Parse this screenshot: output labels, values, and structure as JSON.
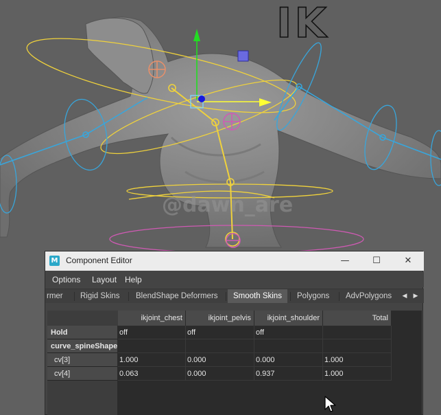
{
  "overlay": {
    "ik_label": "IK",
    "watermark": "@dawn_are"
  },
  "window": {
    "title": "Component Editor",
    "app_icon_letter": "M",
    "minimize_glyph": "—",
    "maximize_glyph": "☐",
    "close_glyph": "✕"
  },
  "menu": {
    "items": [
      "Options",
      "Layout",
      "Help"
    ]
  },
  "tabs": {
    "items": [
      "rmer",
      "Rigid Skins",
      "BlendShape Deformers",
      "Smooth Skins",
      "Polygons",
      "AdvPolygons"
    ],
    "active": "Smooth Skins",
    "scroll_left_glyph": "◀",
    "scroll_right_glyph": "▶"
  },
  "table": {
    "columns": [
      "ikjoint_chest",
      "ikjoint_pelvis",
      "ikjoint_shoulder",
      "Total"
    ],
    "rows": [
      {
        "label": "Hold",
        "values": [
          "off",
          "off",
          "off",
          ""
        ]
      },
      {
        "label": "curve_spineShape",
        "values": [
          "",
          "",
          "",
          ""
        ]
      },
      {
        "label": "cv[3]",
        "values": [
          "1.000",
          "0.000",
          "0.000",
          "1.000"
        ]
      },
      {
        "label": "cv[4]",
        "values": [
          "0.063",
          "0.000",
          "0.937",
          "1.000"
        ]
      }
    ]
  },
  "colors": {
    "viewport_bg": "#606060",
    "ik_curve_yellow": "#f0d23c",
    "fk_circle_blue": "#38a6dc",
    "pelvis_pink": "#d05ab4",
    "translate_y_green": "#22dd22",
    "translate_x_yellow": "#ffff33",
    "editor_bg": "#444444",
    "title_bar_bg": "#ececec"
  }
}
